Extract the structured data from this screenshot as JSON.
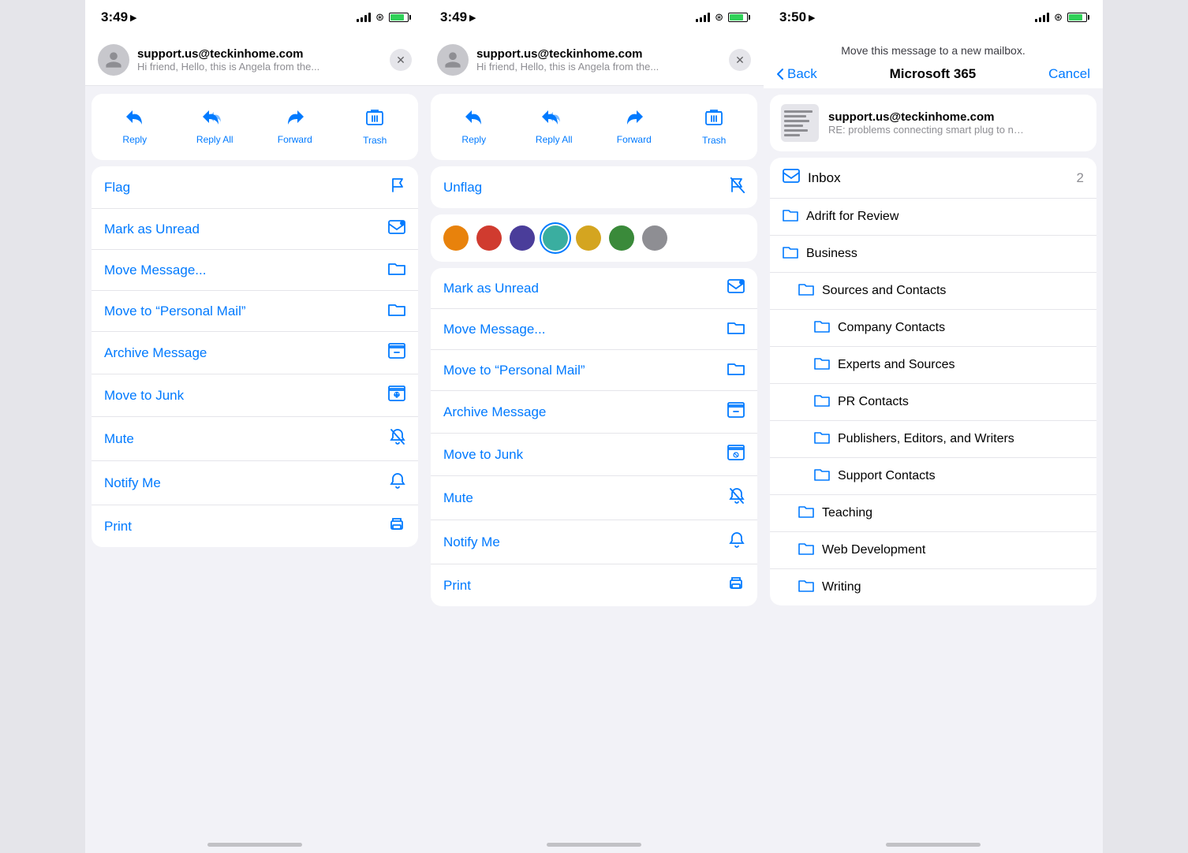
{
  "phone1": {
    "statusBar": {
      "time": "3:49",
      "hasLocation": true
    },
    "emailHeader": {
      "from": "support.us@teckinhome.com",
      "preview": "Hi friend,   Hello, this is Angela from the..."
    },
    "actionButtons": [
      {
        "id": "reply",
        "label": "Reply",
        "icon": "↩"
      },
      {
        "id": "reply-all",
        "label": "Reply All",
        "icon": "↩↩"
      },
      {
        "id": "forward",
        "label": "Forward",
        "icon": "↪"
      },
      {
        "id": "trash",
        "label": "Trash",
        "icon": "🗑"
      }
    ],
    "menuItems": [
      {
        "id": "flag",
        "label": "Flag",
        "icon": "flag"
      },
      {
        "id": "mark-unread",
        "label": "Mark as Unread",
        "icon": "envelope"
      },
      {
        "id": "move-message",
        "label": "Move Message...",
        "icon": "folder"
      },
      {
        "id": "move-personal",
        "label": "Move to “Personal Mail”",
        "icon": "folder"
      },
      {
        "id": "archive",
        "label": "Archive Message",
        "icon": "archive"
      },
      {
        "id": "junk",
        "label": "Move to Junk",
        "icon": "junk"
      },
      {
        "id": "mute",
        "label": "Mute",
        "icon": "bell-slash"
      },
      {
        "id": "notify",
        "label": "Notify Me",
        "icon": "bell"
      },
      {
        "id": "print",
        "label": "Print",
        "icon": "printer"
      }
    ]
  },
  "phone2": {
    "statusBar": {
      "time": "3:49",
      "hasLocation": true
    },
    "emailHeader": {
      "from": "support.us@teckinhome.com",
      "preview": "Hi friend,   Hello, this is Angela from the..."
    },
    "actionButtons": [
      {
        "id": "reply",
        "label": "Reply",
        "icon": "↩"
      },
      {
        "id": "reply-all",
        "label": "Reply All",
        "icon": "↩↩"
      },
      {
        "id": "forward",
        "label": "Forward",
        "icon": "↪"
      },
      {
        "id": "trash",
        "label": "Trash",
        "icon": "🗑"
      }
    ],
    "swatches": [
      {
        "id": "orange",
        "color": "#e8820c"
      },
      {
        "id": "red",
        "color": "#d03b2f"
      },
      {
        "id": "purple",
        "color": "#4a3d9a"
      },
      {
        "id": "teal",
        "color": "#3aaea0",
        "selected": true
      },
      {
        "id": "yellow",
        "color": "#d4a520"
      },
      {
        "id": "green",
        "color": "#3a8a3a"
      },
      {
        "id": "gray",
        "color": "#8e8e93"
      }
    ],
    "menuItems": [
      {
        "id": "unflag",
        "label": "Unflag",
        "icon": "flag-slash"
      },
      {
        "id": "mark-unread",
        "label": "Mark as Unread",
        "icon": "envelope"
      },
      {
        "id": "move-message",
        "label": "Move Message...",
        "icon": "folder"
      },
      {
        "id": "move-personal",
        "label": "Move to “Personal Mail”",
        "icon": "folder"
      },
      {
        "id": "archive",
        "label": "Archive Message",
        "icon": "archive"
      },
      {
        "id": "junk",
        "label": "Move to Junk",
        "icon": "junk"
      },
      {
        "id": "mute",
        "label": "Mute",
        "icon": "bell-slash"
      },
      {
        "id": "notify",
        "label": "Notify Me",
        "icon": "bell"
      },
      {
        "id": "print",
        "label": "Print",
        "icon": "printer"
      }
    ]
  },
  "phone3": {
    "statusBar": {
      "time": "3:50",
      "hasLocation": true
    },
    "hint": "Move this message to a new mailbox.",
    "nav": {
      "back": "Back",
      "title": "Microsoft 365",
      "cancel": "Cancel"
    },
    "emailPreview": {
      "from": "support.us@teckinhome.com",
      "subject": "RE: problems connecting smart plug to net..."
    },
    "mailboxes": {
      "inbox": {
        "label": "Inbox",
        "count": "2"
      },
      "folders": [
        {
          "id": "adrift",
          "label": "Adrift for Review",
          "indent": 0
        },
        {
          "id": "business",
          "label": "Business",
          "indent": 0
        },
        {
          "id": "sources-contacts",
          "label": "Sources and Contacts",
          "indent": 1
        },
        {
          "id": "company-contacts",
          "label": "Company Contacts",
          "indent": 2
        },
        {
          "id": "experts-sources",
          "label": "Experts and Sources",
          "indent": 2
        },
        {
          "id": "pr-contacts",
          "label": "PR Contacts",
          "indent": 2
        },
        {
          "id": "publishers",
          "label": "Publishers, Editors, and Writers",
          "indent": 2
        },
        {
          "id": "support-contacts",
          "label": "Support Contacts",
          "indent": 2
        },
        {
          "id": "teaching",
          "label": "Teaching",
          "indent": 1
        },
        {
          "id": "web-dev",
          "label": "Web Development",
          "indent": 1
        },
        {
          "id": "writing",
          "label": "Writing",
          "indent": 1
        }
      ]
    }
  }
}
